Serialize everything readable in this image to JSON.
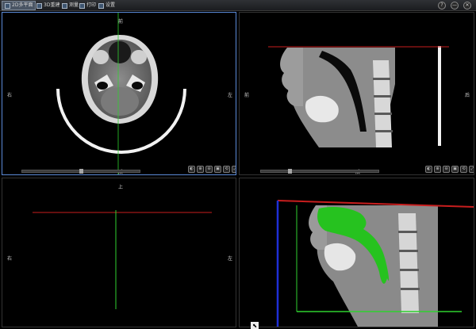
{
  "toolbar": {
    "tabs": [
      {
        "label": "2D多平面",
        "active": true
      },
      {
        "label": "3D重建",
        "active": false
      },
      {
        "label": "测量",
        "active": false
      },
      {
        "label": "打印",
        "active": false
      },
      {
        "label": "设置",
        "active": false
      }
    ],
    "window_buttons": [
      "?",
      "—",
      "✕"
    ]
  },
  "viewports": {
    "axial": {
      "info_tl": [
        "",
        ""
      ],
      "info_tr": [
        "",
        ""
      ],
      "orientation": {
        "top": "前",
        "bottom": "后",
        "left": "右",
        "right": "左"
      },
      "slider_label": "",
      "tools": [
        "◐",
        "⊕",
        "⊖",
        "▣",
        "⟲",
        "⤢"
      ]
    },
    "sagittal": {
      "info_tl": [
        "",
        ""
      ],
      "info_tr": [
        "",
        ""
      ],
      "orientation": {
        "bottom": "后",
        "left": "前",
        "right": "后"
      },
      "slider_label": "",
      "tools": [
        "◐",
        "⊕",
        "⊖",
        "▣",
        "⟲",
        "⤢"
      ]
    },
    "coronal": {
      "info_tl": [
        "",
        ""
      ],
      "info_tr": [
        "",
        ""
      ],
      "orientation": {
        "top": "上",
        "left": "右",
        "right": "左"
      }
    },
    "volume3d": {
      "info_tl": [
        ""
      ]
    }
  },
  "colors": {
    "active_border": "#5b8ad8",
    "crosshair_green": "#2fd12f",
    "crosshair_red": "#c81e1e",
    "box_blue": "#1e2fd6",
    "airway_green": "#26c21f"
  }
}
